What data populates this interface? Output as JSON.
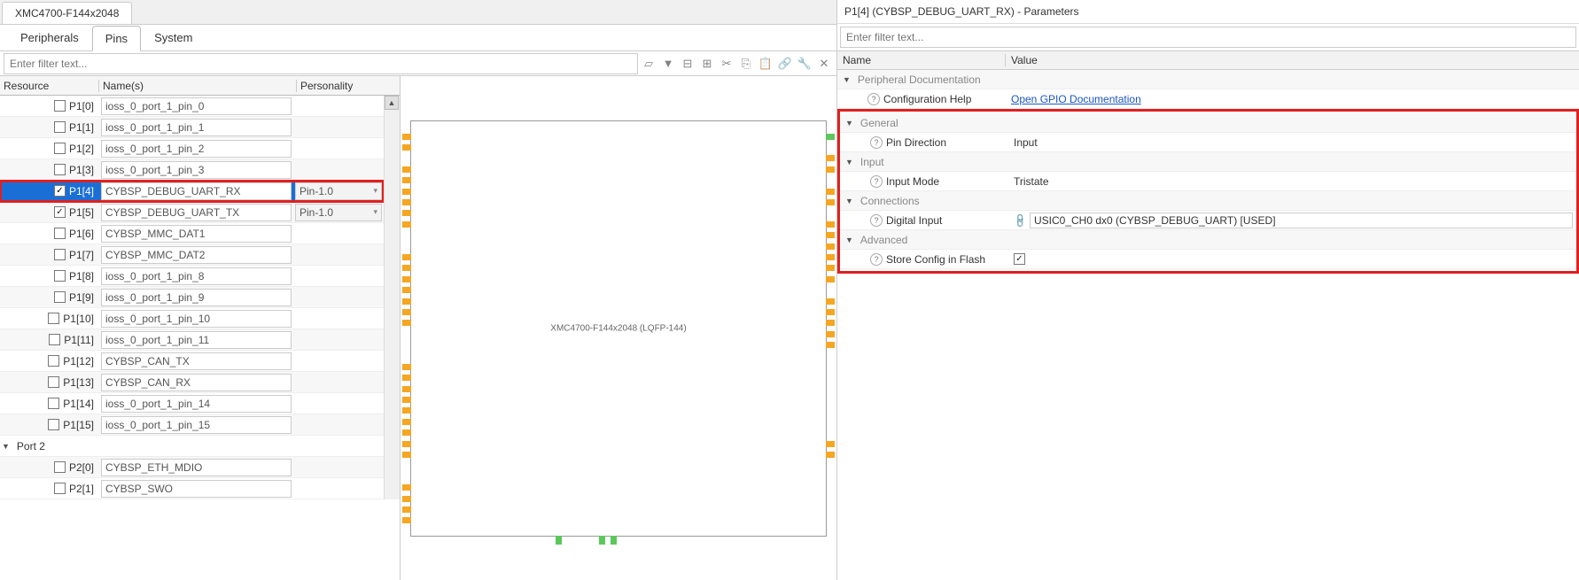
{
  "doc_tab": "XMC4700-F144x2048",
  "section_tabs": {
    "peripherals": "Peripherals",
    "pins": "Pins",
    "system": "System",
    "active": "pins"
  },
  "filter_placeholder": "Enter filter text...",
  "columns": {
    "resource": "Resource",
    "names": "Name(s)",
    "personality": "Personality"
  },
  "personality_pin10": "Pin-1.0",
  "rows": [
    {
      "res": "P1[0]",
      "checked": false,
      "name": "ioss_0_port_1_pin_0",
      "pers": ""
    },
    {
      "res": "P1[1]",
      "checked": false,
      "name": "ioss_0_port_1_pin_1",
      "pers": ""
    },
    {
      "res": "P1[2]",
      "checked": false,
      "name": "ioss_0_port_1_pin_2",
      "pers": ""
    },
    {
      "res": "P1[3]",
      "checked": false,
      "name": "ioss_0_port_1_pin_3",
      "pers": ""
    },
    {
      "res": "P1[4]",
      "checked": true,
      "name": "CYBSP_DEBUG_UART_RX",
      "pers": "Pin-1.0",
      "selected": true,
      "highlighted": true
    },
    {
      "res": "P1[5]",
      "checked": true,
      "name": "CYBSP_DEBUG_UART_TX",
      "pers": "Pin-1.0"
    },
    {
      "res": "P1[6]",
      "checked": false,
      "name": "CYBSP_MMC_DAT1",
      "pers": ""
    },
    {
      "res": "P1[7]",
      "checked": false,
      "name": "CYBSP_MMC_DAT2",
      "pers": ""
    },
    {
      "res": "P1[8]",
      "checked": false,
      "name": "ioss_0_port_1_pin_8",
      "pers": ""
    },
    {
      "res": "P1[9]",
      "checked": false,
      "name": "ioss_0_port_1_pin_9",
      "pers": ""
    },
    {
      "res": "P1[10]",
      "checked": false,
      "name": "ioss_0_port_1_pin_10",
      "pers": ""
    },
    {
      "res": "P1[11]",
      "checked": false,
      "name": "ioss_0_port_1_pin_11",
      "pers": ""
    },
    {
      "res": "P1[12]",
      "checked": false,
      "name": "CYBSP_CAN_TX",
      "pers": ""
    },
    {
      "res": "P1[13]",
      "checked": false,
      "name": "CYBSP_CAN_RX",
      "pers": ""
    },
    {
      "res": "P1[14]",
      "checked": false,
      "name": "ioss_0_port_1_pin_14",
      "pers": ""
    },
    {
      "res": "P1[15]",
      "checked": false,
      "name": "ioss_0_port_1_pin_15",
      "pers": ""
    }
  ],
  "group_row": {
    "label": "Port 2"
  },
  "rows2": [
    {
      "res": "P2[0]",
      "checked": false,
      "name": "CYBSP_ETH_MDIO",
      "pers": ""
    },
    {
      "res": "P2[1]",
      "checked": false,
      "name": "CYBSP_SWO",
      "pers": ""
    }
  ],
  "chip_label": "XMC4700-F144x2048 (LQFP-144)",
  "param_title": "P1[4] (CYBSP_DEBUG_UART_RX) - Parameters",
  "param_filter_placeholder": "Enter filter text...",
  "param_cols": {
    "name": "Name",
    "value": "Value"
  },
  "params": {
    "periph_doc": "Peripheral Documentation",
    "config_help": "Configuration Help",
    "config_help_link": "Open GPIO Documentation",
    "general": "General",
    "pin_direction": "Pin Direction",
    "pin_direction_val": "Input",
    "input": "Input",
    "input_mode": "Input Mode",
    "input_mode_val": "Tristate",
    "connections": "Connections",
    "digital_input": "Digital Input",
    "digital_input_val": "USIC0_CH0 dx0 (CYBSP_DEBUG_UART) [USED]",
    "advanced": "Advanced",
    "store_flash": "Store Config in Flash"
  },
  "chip_pins": {
    "left": [
      "o",
      "o",
      "",
      "o",
      "o",
      "o",
      "o",
      "o",
      "o",
      "",
      "",
      "o",
      "o",
      "o",
      "o",
      "o",
      "o",
      "o",
      "",
      "",
      "",
      "o",
      "o",
      "o",
      "o",
      "o",
      "o",
      "o",
      "o",
      "o",
      "",
      "",
      "o",
      "o",
      "o",
      "o"
    ],
    "right": [
      "g",
      "",
      "o",
      "o",
      "",
      "o",
      "o",
      "",
      "o",
      "o",
      "o",
      "o",
      "o",
      "o",
      "",
      "o",
      "o",
      "o",
      "o",
      "o",
      "",
      "",
      "",
      "",
      "",
      "",
      "",
      "",
      "o",
      "o",
      "",
      "",
      "",
      "",
      "",
      ""
    ],
    "top": [
      "",
      "",
      "",
      "",
      "",
      "",
      "",
      "",
      "",
      "",
      "",
      "",
      "",
      "",
      "",
      "",
      "",
      "",
      "",
      "",
      "",
      "",
      "",
      "",
      "",
      "",
      "",
      "",
      "",
      "",
      "",
      "",
      "",
      "",
      "",
      ""
    ],
    "bottom": [
      "",
      "",
      "",
      "",
      "",
      "",
      "",
      "",
      "",
      "",
      "",
      "",
      "g",
      "",
      "",
      "",
      "g",
      "g",
      "",
      "",
      "",
      "",
      "",
      "",
      "",
      "",
      "",
      "",
      "",
      "",
      "",
      "",
      "",
      "",
      "",
      ""
    ]
  }
}
